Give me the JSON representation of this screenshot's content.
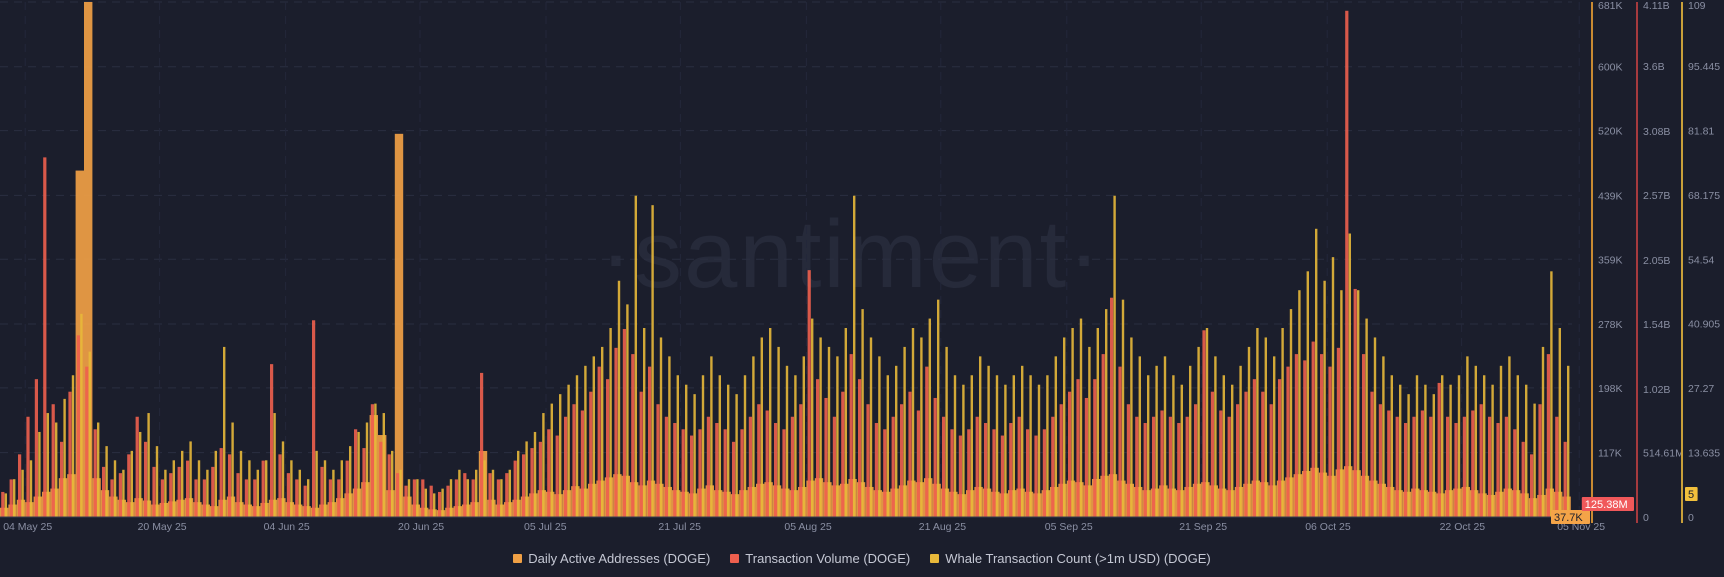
{
  "watermark": "·santiment·",
  "chart_data": {
    "type": "bar",
    "start_date": "2025-05-01",
    "x_ticks": [
      {
        "label": "04 May 25",
        "day": 3
      },
      {
        "label": "20 May 25",
        "day": 19
      },
      {
        "label": "04 Jun 25",
        "day": 34
      },
      {
        "label": "20 Jun 25",
        "day": 50
      },
      {
        "label": "05 Jul 25",
        "day": 65
      },
      {
        "label": "21 Jul 25",
        "day": 81
      },
      {
        "label": "05 Aug 25",
        "day": 96
      },
      {
        "label": "21 Aug 25",
        "day": 112
      },
      {
        "label": "05 Sep 25",
        "day": 127
      },
      {
        "label": "21 Sep 25",
        "day": 143
      },
      {
        "label": "06 Oct 25",
        "day": 158
      },
      {
        "label": "22 Oct 25",
        "day": 174
      },
      {
        "label": "05 Nov 25",
        "day": 188
      }
    ],
    "axes": [
      {
        "id": "daa",
        "color": "#c98a32",
        "range": [
          36.4,
          681
        ],
        "unit": "K",
        "ticks": [
          {
            "v": 681,
            "label": "681K"
          },
          {
            "v": 600,
            "label": "600K"
          },
          {
            "v": 520,
            "label": "520K"
          },
          {
            "v": 439,
            "label": "439K"
          },
          {
            "v": 359,
            "label": "359K"
          },
          {
            "v": 278,
            "label": "278K"
          },
          {
            "v": 198,
            "label": "198K"
          },
          {
            "v": 117,
            "label": "117K"
          }
        ],
        "current": {
          "v": 37.7,
          "label": "37.7K",
          "color": "#f4a448"
        }
      },
      {
        "id": "vol",
        "color": "#a63a3e",
        "range": [
          0,
          4.11
        ],
        "unit": "B",
        "ticks": [
          {
            "v": 4.11,
            "label": "4.11B"
          },
          {
            "v": 3.6,
            "label": "3.6B"
          },
          {
            "v": 3.08,
            "label": "3.08B"
          },
          {
            "v": 2.57,
            "label": "2.57B"
          },
          {
            "v": 2.05,
            "label": "2.05B"
          },
          {
            "v": 1.54,
            "label": "1.54B"
          },
          {
            "v": 1.02,
            "label": "1.02B"
          },
          {
            "v": 0.51461,
            "label": "514.61M"
          },
          {
            "v": 0,
            "label": "0"
          }
        ],
        "current": {
          "v": 0.12538,
          "label": "125.38M",
          "color": "#f0585a"
        }
      },
      {
        "id": "whale",
        "color": "#c9a03a",
        "range": [
          0,
          109
        ],
        "unit": "",
        "ticks": [
          {
            "v": 109,
            "label": "109"
          },
          {
            "v": 95.445,
            "label": "95.445"
          },
          {
            "v": 81.81,
            "label": "81.81"
          },
          {
            "v": 68.175,
            "label": "68.175"
          },
          {
            "v": 54.54,
            "label": "54.54"
          },
          {
            "v": 40.905,
            "label": "40.905"
          },
          {
            "v": 27.27,
            "label": "27.27"
          },
          {
            "v": 13.635,
            "label": "13.635"
          },
          {
            "v": 0,
            "label": "0"
          }
        ],
        "current": {
          "v": 5,
          "label": "5",
          "color": "#f2c03c"
        }
      }
    ],
    "series": [
      {
        "name": "Daily Active Addresses (DOGE)",
        "axis": "daa",
        "color": "#f0a045",
        "values": [
          48,
          52,
          58,
          55,
          62,
          68,
          72,
          85,
          90,
          470,
          681,
          85,
          70,
          62,
          58,
          55,
          60,
          57,
          52,
          54,
          56,
          58,
          60,
          55,
          52,
          50,
          58,
          62,
          55,
          52,
          50,
          54,
          58,
          60,
          55,
          52,
          50,
          48,
          52,
          55,
          60,
          66,
          72,
          80,
          164,
          139,
          70,
          516,
          62,
          52,
          48,
          46,
          45,
          48,
          50,
          52,
          55,
          119,
          58,
          52,
          55,
          58,
          62,
          66,
          70,
          68,
          65,
          70,
          75,
          72,
          78,
          82,
          86,
          90,
          88,
          80,
          76,
          82,
          78,
          74,
          70,
          68,
          66,
          72,
          76,
          70,
          68,
          65,
          70,
          74,
          78,
          80,
          76,
          72,
          70,
          74,
          82,
          85,
          80,
          76,
          78,
          84,
          80,
          74,
          70,
          68,
          72,
          76,
          82,
          80,
          85,
          78,
          72,
          68,
          65,
          70,
          74,
          72,
          68,
          66,
          70,
          72,
          68,
          66,
          70,
          74,
          78,
          82,
          80,
          76,
          84,
          88,
          90,
          82,
          78,
          74,
          70,
          72,
          76,
          72,
          70,
          74,
          78,
          80,
          76,
          72,
          70,
          74,
          78,
          82,
          80,
          76,
          82,
          86,
          90,
          94,
          98,
          92,
          88,
          96,
          100,
          95,
          88,
          82,
          78,
          74,
          70,
          68,
          72,
          70,
          68,
          66,
          70,
          72,
          74,
          70,
          66,
          64,
          68,
          72,
          70,
          66,
          60,
          64,
          72,
          68,
          62
        ]
      },
      {
        "name": "Transaction Volume (DOGE)",
        "axis": "vol",
        "color": "#ee5f4e",
        "values": [
          0.2,
          0.3,
          0.5,
          0.8,
          1.1,
          2.87,
          0.9,
          0.6,
          1.0,
          1.45,
          1.2,
          0.7,
          0.4,
          0.3,
          0.35,
          0.5,
          0.8,
          0.6,
          0.4,
          0.3,
          0.35,
          0.4,
          0.45,
          0.3,
          0.3,
          0.4,
          0.55,
          0.5,
          0.35,
          0.3,
          0.3,
          0.45,
          1.22,
          0.5,
          0.35,
          0.3,
          0.25,
          1.57,
          0.4,
          0.3,
          0.3,
          0.45,
          0.7,
          0.55,
          0.9,
          0.6,
          0.5,
          0.35,
          0.25,
          0.3,
          0.3,
          0.25,
          0.2,
          0.25,
          0.3,
          0.35,
          0.3,
          1.15,
          0.35,
          0.3,
          0.35,
          0.45,
          0.5,
          0.55,
          0.6,
          0.7,
          0.65,
          0.8,
          0.9,
          0.85,
          1.0,
          1.2,
          1.1,
          1.35,
          1.5,
          1.3,
          1.0,
          1.2,
          0.9,
          0.8,
          0.75,
          0.7,
          0.65,
          0.7,
          0.8,
          0.75,
          0.7,
          0.6,
          0.7,
          0.8,
          0.9,
          0.85,
          0.75,
          0.7,
          0.8,
          0.9,
          1.97,
          1.1,
          0.95,
          0.8,
          1.0,
          1.3,
          1.1,
          0.9,
          0.75,
          0.7,
          0.8,
          0.9,
          1.0,
          0.85,
          1.2,
          0.95,
          0.8,
          0.7,
          0.65,
          0.7,
          0.8,
          0.75,
          0.7,
          0.65,
          0.75,
          0.8,
          0.7,
          0.65,
          0.7,
          0.8,
          0.9,
          1.0,
          1.1,
          0.95,
          1.1,
          1.3,
          1.75,
          1.2,
          0.9,
          0.8,
          0.75,
          0.8,
          0.85,
          0.8,
          0.75,
          0.8,
          0.9,
          1.49,
          1.0,
          0.85,
          0.8,
          0.9,
          1.0,
          1.1,
          1.0,
          0.9,
          1.1,
          1.2,
          1.3,
          1.25,
          1.4,
          1.3,
          1.2,
          1.35,
          4.04,
          1.82,
          1.3,
          1.0,
          0.9,
          0.85,
          0.8,
          0.75,
          0.8,
          0.85,
          0.8,
          1.07,
          0.8,
          0.75,
          0.8,
          0.85,
          0.9,
          0.8,
          0.75,
          0.8,
          0.7,
          0.6,
          0.5,
          0.9,
          1.3,
          0.8,
          0.6
        ]
      },
      {
        "name": "Whale Transaction Count (>1m USD) (DOGE)",
        "axis": "whale",
        "color": "#e8b83a",
        "values": [
          5,
          8,
          10,
          12,
          18,
          22,
          20,
          25,
          30,
          43,
          35,
          20,
          15,
          12,
          10,
          14,
          18,
          22,
          15,
          10,
          12,
          14,
          16,
          12,
          10,
          14,
          36,
          20,
          14,
          12,
          10,
          12,
          22,
          16,
          12,
          10,
          8,
          14,
          12,
          10,
          12,
          15,
          18,
          20,
          24,
          22,
          14,
          10,
          8,
          8,
          6,
          5,
          6,
          8,
          10,
          8,
          10,
          12,
          10,
          8,
          10,
          14,
          16,
          18,
          22,
          24,
          26,
          28,
          30,
          32,
          34,
          36,
          40,
          50,
          45,
          68,
          40,
          66,
          38,
          34,
          30,
          28,
          26,
          30,
          34,
          30,
          28,
          26,
          30,
          34,
          38,
          40,
          36,
          32,
          30,
          34,
          42,
          38,
          36,
          34,
          40,
          68,
          44,
          38,
          34,
          30,
          32,
          36,
          40,
          38,
          42,
          46,
          36,
          30,
          28,
          30,
          34,
          32,
          30,
          28,
          30,
          32,
          30,
          28,
          30,
          34,
          38,
          40,
          42,
          36,
          40,
          44,
          68,
          46,
          38,
          34,
          30,
          32,
          34,
          30,
          28,
          32,
          36,
          40,
          34,
          30,
          28,
          32,
          36,
          40,
          38,
          34,
          40,
          44,
          48,
          52,
          61,
          50,
          55,
          48,
          60,
          48,
          42,
          38,
          34,
          30,
          28,
          26,
          30,
          28,
          26,
          30,
          28,
          30,
          34,
          32,
          30,
          28,
          32,
          34,
          30,
          28,
          24,
          36,
          52,
          40,
          32
        ]
      }
    ],
    "grid": true,
    "legend_position": "bottom"
  },
  "legend": [
    {
      "label": "Daily Active Addresses (DOGE)",
      "color": "#f0a045"
    },
    {
      "label": "Transaction Volume (DOGE)",
      "color": "#ee5f4e"
    },
    {
      "label": "Whale Transaction Count (>1m USD) (DOGE)",
      "color": "#e8b83a"
    }
  ]
}
